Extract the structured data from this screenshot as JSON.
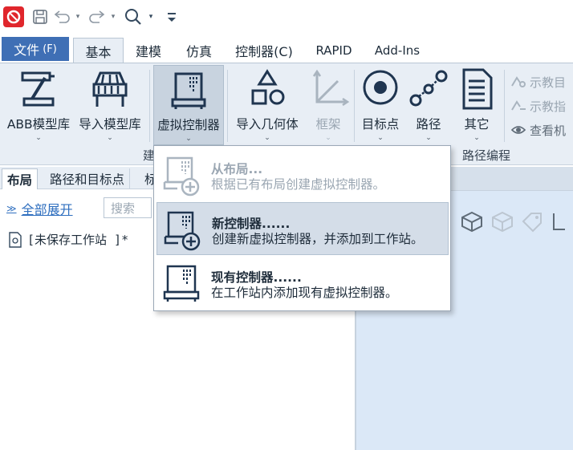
{
  "quick_access": {
    "logo_icon": "abb-robotstudio-logo-icon",
    "save_icon": "save-icon",
    "undo_icon": "undo-icon",
    "redo_icon": "redo-icon",
    "search_icon": "search-icon",
    "customize_icon": "customize-qat-icon"
  },
  "tabs": {
    "file": "文件",
    "file_key": "(F)",
    "basic": "基本",
    "modeling": "建模",
    "simulation": "仿真",
    "controller": "控制器(C)",
    "rapid": "RAPID",
    "addins": "Add-Ins"
  },
  "ribbon": {
    "abb_library": "ABB模型库",
    "import_library": "导入模型库",
    "virtual_controller": "虚拟控制器",
    "import_geometry": "导入几何体",
    "frame": "框架",
    "target": "目标点",
    "path": "路径",
    "other": "其它",
    "teach_target": "示教目",
    "teach_instruction": "示教指",
    "view_robot": "查看机",
    "group_build": "建",
    "group_path_programming": "路径编程"
  },
  "left_pane": {
    "tab_layout": "布局",
    "tab_paths": "路径和目标点",
    "tab_third": "标",
    "expand_all": "全部展开",
    "search_placeholder": "搜索",
    "station_item": "[未保存工作站 ]*"
  },
  "menu": {
    "from_layout_title": "从布局...",
    "from_layout_desc": "根据已有布局创建虚拟控制器。",
    "new_controller_title": "新控制器......",
    "new_controller_desc": "创建新虚拟控制器，并添加到工作站。",
    "existing_controller_title": "现有控制器......",
    "existing_controller_desc": "在工作站内添加现有虚拟控制器。"
  },
  "colors": {
    "accent_file_tab": "#3f6fb5",
    "ribbon_bg": "#e8eef5",
    "icon_dark": "#1f3550",
    "disabled": "#9aa6b2",
    "link": "#2f6fbf",
    "logo_red": "#e0262c"
  }
}
